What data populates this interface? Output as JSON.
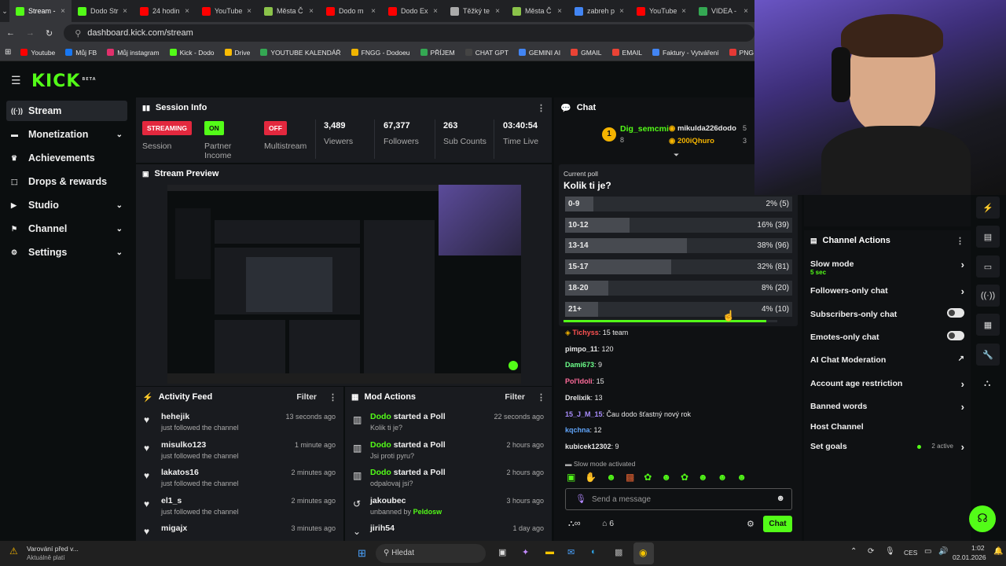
{
  "tabs": [
    {
      "label": "Stream -",
      "color": "#53fc18",
      "icon": "kick-icon",
      "active": true
    },
    {
      "label": "Dodo Str",
      "color": "#53fc18",
      "icon": "kick-icon"
    },
    {
      "label": "24 hodin",
      "color": "#ff0000",
      "icon": "youtube-icon"
    },
    {
      "label": "YouTube",
      "color": "#ff0000",
      "icon": "youtube-icon"
    },
    {
      "label": "Města Č",
      "color": "#8bc34a",
      "icon": "sheet-icon"
    },
    {
      "label": "Dodo m",
      "color": "#ff0000",
      "icon": "youtube-icon"
    },
    {
      "label": "Dodo Ex",
      "color": "#ff0000",
      "icon": "youtube-icon"
    },
    {
      "label": "Těžký te",
      "color": "#aaaaaa",
      "icon": "page-icon"
    },
    {
      "label": "Města Č",
      "color": "#8bc34a",
      "icon": "sheet-icon"
    },
    {
      "label": "zabreh p",
      "color": "#4285f4",
      "icon": "google-icon"
    },
    {
      "label": "YouTube",
      "color": "#ff0000",
      "icon": "youtube-icon"
    },
    {
      "label": "VIDEA -",
      "color": "#34a853",
      "icon": "sheets-icon"
    }
  ],
  "address": {
    "url": "dashboard.kick.com/stream"
  },
  "bookmarks": [
    {
      "label": "Youtube",
      "color": "#ff0000"
    },
    {
      "label": "Můj FB",
      "color": "#1877f2"
    },
    {
      "label": "Můj instagram",
      "color": "#e1306c"
    },
    {
      "label": "Kick - Dodo",
      "color": "#53fc18"
    },
    {
      "label": "Drive",
      "color": "#fbbc04"
    },
    {
      "label": "YOUTUBE KALENDÁŘ",
      "color": "#34a853"
    },
    {
      "label": "FNGG - Dodoeu",
      "color": "#f0b400"
    },
    {
      "label": "PŘÍJEM",
      "color": "#34a853"
    },
    {
      "label": "CHAT GPT",
      "color": "#444444"
    },
    {
      "label": "GEMINI AI",
      "color": "#4285f4"
    },
    {
      "label": "GMAIL",
      "color": "#ea4335"
    },
    {
      "label": "EMAIL",
      "color": "#ea4335"
    },
    {
      "label": "Faktury - Vytváření",
      "color": "#4285f4"
    },
    {
      "label": "PNG to PDF",
      "color": "#e53935"
    }
  ],
  "brand": {
    "logo": "KICK",
    "beta": "BETA",
    "accent": "#53fc18"
  },
  "sidebar": [
    {
      "label": "Stream",
      "icon": "stream-icon",
      "active": true,
      "chevron": false
    },
    {
      "label": "Monetization",
      "icon": "money-icon",
      "chevron": true
    },
    {
      "label": "Achievements",
      "icon": "trophy-icon",
      "chevron": false
    },
    {
      "label": "Drops & rewards",
      "icon": "gift-icon",
      "chevron": false
    },
    {
      "label": "Studio",
      "icon": "studio-icon",
      "chevron": true
    },
    {
      "label": "Channel",
      "icon": "channel-icon",
      "chevron": true
    },
    {
      "label": "Settings",
      "icon": "gear-icon",
      "chevron": true
    }
  ],
  "session": {
    "title": "Session Info",
    "streaming_badge": "STREAMING",
    "streaming_label": "Session",
    "partner_badge": "ON",
    "partner_label": "Partner Income",
    "multistream_badge": "OFF",
    "multistream_label": "Multistream",
    "viewers": "3,489",
    "viewers_label": "Viewers",
    "followers": "67,377",
    "followers_label": "Followers",
    "subs": "263",
    "subs_label": "Sub Counts",
    "time": "03:40:54",
    "time_label": "Time Live"
  },
  "preview": {
    "title": "Stream Preview"
  },
  "activity": {
    "title": "Activity Feed",
    "filter": "Filter",
    "items": [
      {
        "name": "hehejik",
        "sub": "just followed the channel",
        "time": "13 seconds ago"
      },
      {
        "name": "misulko123",
        "sub": "just followed the channel",
        "time": "1 minute ago"
      },
      {
        "name": "lakatos16",
        "sub": "just followed the channel",
        "time": "2 minutes ago"
      },
      {
        "name": "el1_s",
        "sub": "just followed the channel",
        "time": "2 minutes ago"
      },
      {
        "name": "migajx",
        "sub": "",
        "time": "3 minutes ago"
      }
    ]
  },
  "mod": {
    "title": "Mod Actions",
    "filter": "Filter",
    "items": [
      {
        "actor": "Dodo",
        "action": " started a Poll",
        "sub": "Kolik ti je?",
        "time": "22 seconds ago",
        "icon": "poll-icon"
      },
      {
        "actor": "Dodo",
        "action": " started a Poll",
        "sub": "Jsi proti pyru?",
        "time": "2 hours ago",
        "icon": "poll-icon"
      },
      {
        "actor": "Dodo",
        "action": " started a Poll",
        "sub": "odpalovaj jsi?",
        "time": "2 hours ago",
        "icon": "poll-icon"
      },
      {
        "actor": "jakoubec",
        "action": "",
        "sub": "unbanned by ",
        "sub2": "Peldosw",
        "time": "3 hours ago",
        "icon": "unban-icon"
      },
      {
        "actor": "jirih54",
        "action": "",
        "sub": "",
        "time": "1 day ago",
        "icon": "chevron-down-icon"
      }
    ]
  },
  "chat": {
    "title": "Chat",
    "top1_name": "Dig_semcmi",
    "top1_count": "8",
    "top2_name": "mikulda226dodo",
    "top2_count": "5",
    "top3_name": "200iQhuro",
    "top3_count": "3",
    "poll_label": "Current poll",
    "poll_question": "Kolik ti je?",
    "poll": [
      {
        "label": "0-9",
        "pct": "2% (5)",
        "frac": 0.02
      },
      {
        "label": "10-12",
        "pct": "16% (39)",
        "frac": 0.16
      },
      {
        "label": "13-14",
        "pct": "38% (96)",
        "frac": 0.38
      },
      {
        "label": "15-17",
        "pct": "32% (81)",
        "frac": 0.32
      },
      {
        "label": "18-20",
        "pct": "8% (20)",
        "frac": 0.08
      },
      {
        "label": "21+",
        "pct": "4% (10)",
        "frac": 0.04
      }
    ],
    "poll_progress": 0.95,
    "messages": [
      {
        "user": "Tichyss",
        "text": ": 15 team",
        "color": "#ff5252"
      },
      {
        "user": "pimpo_11",
        "text": ": 120",
        "color": "#e8e8e8"
      },
      {
        "user": "Dami673",
        "text": ": 9",
        "color": "#6cff8a"
      },
      {
        "user": "Pol'ldoli",
        "text": ": 15",
        "color": "#ff6b9a"
      },
      {
        "user": "Drelixik",
        "text": ": 13",
        "color": "#e8e8e8"
      },
      {
        "user": "15_J_M_15",
        "text": ": Čau dodo šťastný nový rok",
        "color": "#a78bfa"
      },
      {
        "user": "kqchna",
        "text": ": 12",
        "color": "#60a5fa"
      },
      {
        "user": "kubicek12302",
        "text": ": 9",
        "color": "#e8e8e8"
      }
    ],
    "slow_notice": "Slow mode activated",
    "input_placeholder": "Send a message",
    "points": "6",
    "send": "Chat"
  },
  "actions": {
    "title": "Channel Actions",
    "items": [
      {
        "label": "Slow mode",
        "sub": "5 sec",
        "type": "arrow"
      },
      {
        "label": "Followers-only chat",
        "type": "arrow"
      },
      {
        "label": "Subscribers-only chat",
        "type": "toggle"
      },
      {
        "label": "Emotes-only chat",
        "type": "toggle"
      },
      {
        "label": "AI Chat Moderation",
        "type": "external"
      },
      {
        "label": "Account age restriction",
        "type": "arrow"
      },
      {
        "label": "Banned words",
        "type": "arrow"
      },
      {
        "label": "Host Channel",
        "type": "none"
      },
      {
        "label": "Set goals",
        "type": "arrow",
        "extra": "2 active"
      }
    ]
  },
  "taskbar": {
    "warning_title": "Varování před v...",
    "warning_sub": "Aktuálně platí",
    "search": "Hledat",
    "lang": "CES",
    "time": "1:02",
    "date": "02.01.2026"
  }
}
